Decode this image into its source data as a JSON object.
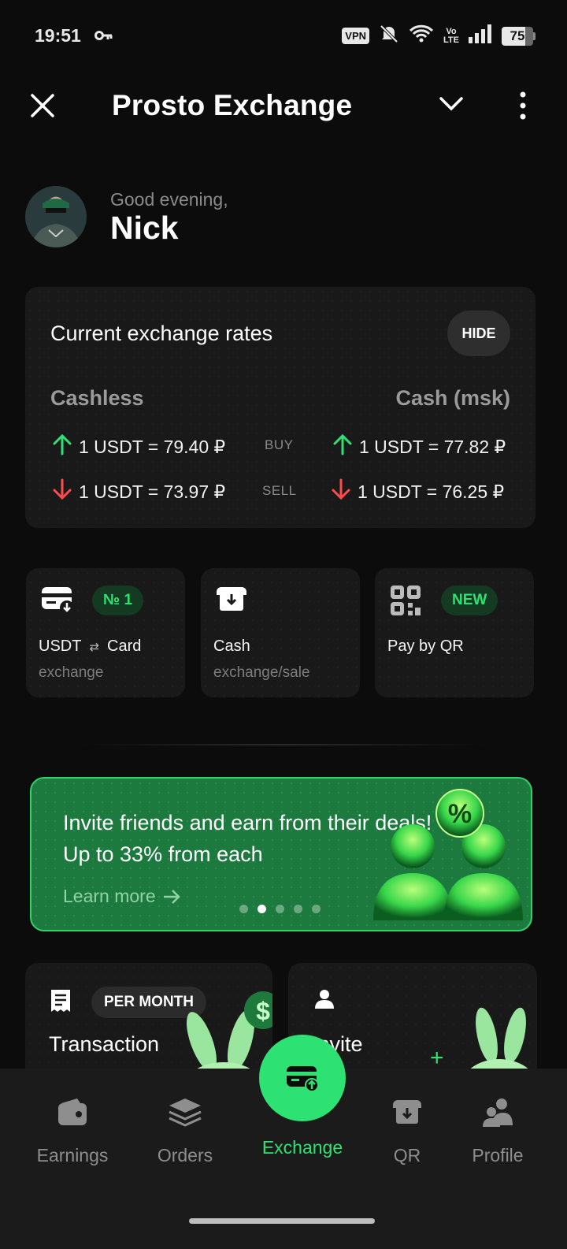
{
  "status_bar": {
    "time": "19:51",
    "vpn": "VPN",
    "volte": [
      "Vo",
      "LTE"
    ],
    "battery": "75"
  },
  "app_bar": {
    "title": "Prosto Exchange"
  },
  "greeting": {
    "hello": "Good evening,",
    "name": "Nick"
  },
  "rates": {
    "title": "Current exchange rates",
    "hide_label": "HIDE",
    "cashless_label": "Cashless",
    "cash_label": "Cash (msk)",
    "buy_label": "BUY",
    "sell_label": "SELL",
    "cashless_buy": "1 USDT = 79.40 ₽",
    "cashless_sell": "1 USDT = 73.97 ₽",
    "cash_buy": "1 USDT = 77.82 ₽",
    "cash_sell": "1 USDT = 76.25 ₽",
    "up_color": "#2ee173",
    "down_color": "#ff4b4b"
  },
  "tiles": [
    {
      "title_left": "USDT",
      "swap": "⇄",
      "title_right": "Card",
      "subtitle": "exchange",
      "badge": "№ 1"
    },
    {
      "title": "Cash",
      "subtitle": "exchange/sale"
    },
    {
      "title": "Pay by QR",
      "badge": "NEW"
    }
  ],
  "banner": {
    "text": "Invite friends and earn from their deals! Up to 33% from each",
    "learn_more": "Learn more",
    "badge_symbol": "%",
    "active_dot": 1
  },
  "promos": [
    {
      "pill": "PER MONTH",
      "title": "Transaction"
    },
    {
      "title": "Invite"
    }
  ],
  "nav": {
    "earnings": "Earnings",
    "orders": "Orders",
    "exchange": "Exchange",
    "qr": "QR",
    "profile": "Profile"
  },
  "colors": {
    "accent": "#2ee173",
    "background": "#0c0c0c",
    "card": "#191919",
    "nav": "#1b1b1b"
  }
}
